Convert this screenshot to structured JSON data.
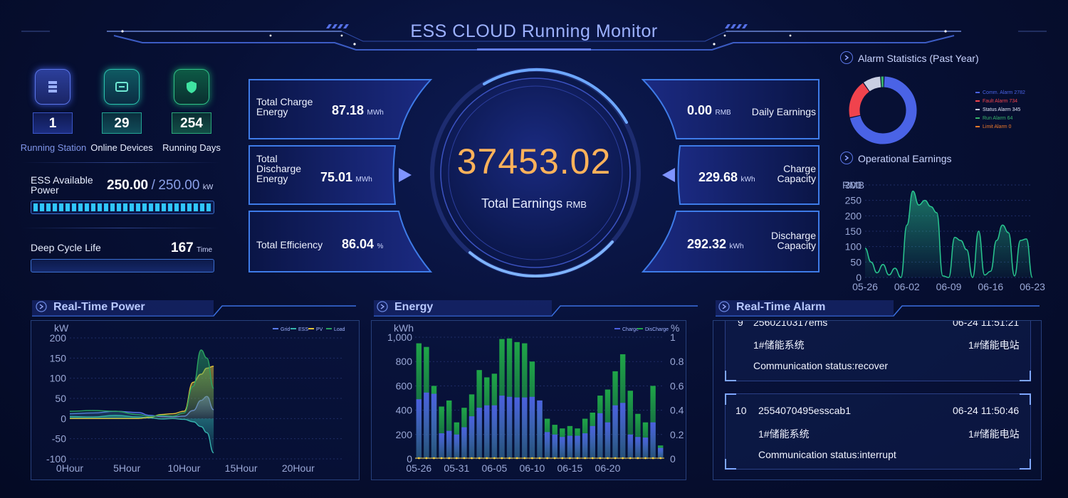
{
  "header": {
    "title": "ESS CLOUD Running Monitor"
  },
  "stats": [
    {
      "value": "1",
      "label": "Running Station",
      "icon": "server-icon",
      "color": "#4e6cf0"
    },
    {
      "value": "29",
      "label": "Online Devices",
      "icon": "device-icon",
      "color": "#27c2a3"
    },
    {
      "value": "254",
      "label": "Running Days",
      "icon": "shield-icon",
      "color": "#22b07a"
    }
  ],
  "ess_power": {
    "label": "ESS Available Power",
    "value": "250.00",
    "separator": "/",
    "total": "250.00",
    "unit": "kW",
    "level_fraction": 1.0
  },
  "cycle_life": {
    "label": "Deep Cycle Life",
    "value": "167",
    "unit": "Time"
  },
  "left_cards": [
    {
      "label": "Total Charge Energy",
      "value": "87.18",
      "unit": "MWh"
    },
    {
      "label": "Total Discharge Energy",
      "value": "75.01",
      "unit": "MWh"
    },
    {
      "label": "Total Efficiency",
      "value": "86.04",
      "unit": "%"
    }
  ],
  "right_cards": [
    {
      "label": "Daily Earnings",
      "value": "0.00",
      "unit": "RMB"
    },
    {
      "label": "Charge Capacity",
      "value": "229.68",
      "unit": "kWh"
    },
    {
      "label": "Discharge Capacity",
      "value": "292.32",
      "unit": "kWh"
    }
  ],
  "center": {
    "value": "37453.02",
    "label": "Total Earnings",
    "unit": "RMB"
  },
  "alarm_stats": {
    "title": "Alarm Statistics (Past Year)",
    "legend": [
      "Comm. Alarm 2782",
      "Fault Alarm 734",
      "Status Alarm 345",
      "Run Alarm 64",
      "Limit Alarm 0"
    ],
    "colors": [
      "#4a63e6",
      "#f0434d",
      "#c9cfe3",
      "#39b36b",
      "#f07a2a"
    ]
  },
  "sections": {
    "operational_earnings": "Operational Earnings",
    "realtime_power": "Real-Time Power",
    "energy": "Energy",
    "realtime_alarm": "Real-Time Alarm"
  },
  "alarms": [
    {
      "index": "9",
      "id": "2560210317ems",
      "time": "06-24 11:51:21",
      "system": "1#储能系统",
      "station": "1#储能电站",
      "status": "Communication status:recover"
    },
    {
      "index": "10",
      "id": "2554070495esscab1",
      "time": "06-24 11:50:46",
      "system": "1#储能系统",
      "station": "1#储能电站",
      "status": "Communication status:interrupt"
    }
  ],
  "chart_data": [
    {
      "type": "pie",
      "title": "Alarm Statistics (Past Year)",
      "categories": [
        "Comm. Alarm",
        "Fault Alarm",
        "Status Alarm",
        "Run Alarm",
        "Limit Alarm"
      ],
      "values": [
        2782,
        734,
        345,
        64,
        0
      ],
      "colors": [
        "#4a63e6",
        "#f0434d",
        "#c9cfe3",
        "#39b36b",
        "#f07a2a"
      ]
    },
    {
      "type": "area",
      "title": "Operational Earnings",
      "ylabel": "RMB",
      "ylim": [
        0,
        300
      ],
      "yticks": [
        "0",
        "50",
        "100",
        "150",
        "200",
        "250",
        "300"
      ],
      "xticks": [
        "05-26",
        "06-02",
        "06-09",
        "06-16",
        "06-23"
      ],
      "x": [
        "05-26",
        "05-27",
        "05-28",
        "05-29",
        "05-30",
        "05-31",
        "06-01",
        "06-02",
        "06-03",
        "06-04",
        "06-05",
        "06-06",
        "06-07",
        "06-08",
        "06-09",
        "06-10",
        "06-11",
        "06-12",
        "06-13",
        "06-14",
        "06-15",
        "06-16",
        "06-17",
        "06-18",
        "06-19",
        "06-20",
        "06-21",
        "06-22",
        "06-23"
      ],
      "values": [
        95,
        50,
        15,
        42,
        8,
        30,
        0,
        170,
        280,
        235,
        250,
        230,
        210,
        5,
        0,
        130,
        120,
        90,
        0,
        150,
        8,
        20,
        120,
        170,
        145,
        5,
        120,
        125,
        0
      ],
      "color": "#29c68f"
    },
    {
      "type": "area",
      "title": "Real-Time Power",
      "ylabel": "kW",
      "ylim": [
        -100,
        200
      ],
      "yticks": [
        "-100",
        "-50",
        "0",
        "50",
        "100",
        "150",
        "200"
      ],
      "xlim": [
        0,
        24
      ],
      "xticks": [
        "0Hour",
        "5Hour",
        "10Hour",
        "15Hour",
        "20Hour"
      ],
      "series": [
        {
          "name": "Grid",
          "color": "#5a7cf0",
          "x": [
            0,
            2,
            4,
            6,
            7,
            8,
            9,
            10,
            10.8,
            11.5,
            12,
            12.6
          ],
          "values": [
            12,
            14,
            18,
            15,
            8,
            5,
            4,
            6,
            20,
            45,
            55,
            22
          ]
        },
        {
          "name": "ESS",
          "color": "#35b3ad",
          "x": [
            0,
            2,
            4,
            6,
            7,
            8,
            9,
            10,
            10.8,
            11.5,
            12,
            12.6
          ],
          "values": [
            5,
            4,
            8,
            4,
            2,
            -1,
            0,
            -2,
            -8,
            -20,
            -35,
            -85
          ]
        },
        {
          "name": "PV",
          "color": "#e3c53a",
          "x": [
            0,
            2,
            4,
            6,
            7,
            8,
            9,
            10,
            10.8,
            11.5,
            12,
            12.6
          ],
          "values": [
            0,
            0,
            0,
            0,
            3,
            10,
            12,
            18,
            90,
            110,
            125,
            130
          ]
        },
        {
          "name": "Load",
          "color": "#2aa160",
          "x": [
            0,
            2,
            4,
            6,
            7,
            8,
            9,
            10,
            10.8,
            11.5,
            12,
            12.6
          ],
          "values": [
            18,
            20,
            18,
            10,
            5,
            8,
            6,
            14,
            80,
            170,
            150,
            75
          ]
        }
      ]
    },
    {
      "type": "bar",
      "title": "Energy",
      "ylabel": "kWh",
      "y2label": "%",
      "ylim": [
        0,
        1000
      ],
      "y2lim": [
        0,
        1
      ],
      "yticks": [
        "0",
        "200",
        "400",
        "600",
        "800",
        "1,000"
      ],
      "y2ticks": [
        "0",
        "0.2",
        "0.4",
        "0.6",
        "0.8",
        "1"
      ],
      "xticks": [
        "05-26",
        "05-31",
        "06-05",
        "06-10",
        "06-15",
        "06-20"
      ],
      "series": [
        {
          "name": "Charge",
          "color": "#4b5fe0",
          "values": [
            490,
            545,
            535,
            210,
            230,
            200,
            260,
            350,
            420,
            440,
            440,
            520,
            510,
            505,
            505,
            510,
            480,
            220,
            200,
            180,
            190,
            190,
            210,
            270,
            375,
            300,
            440,
            460,
            200,
            180,
            175,
            300,
            90
          ]
        },
        {
          "name": "DisCharge",
          "color": "#1fa548",
          "values": [
            950,
            920,
            600,
            430,
            480,
            300,
            420,
            530,
            730,
            670,
            700,
            985,
            990,
            960,
            950,
            800,
            480,
            330,
            280,
            250,
            270,
            250,
            330,
            380,
            520,
            570,
            720,
            860,
            560,
            370,
            300,
            600,
            110
          ]
        }
      ]
    }
  ]
}
